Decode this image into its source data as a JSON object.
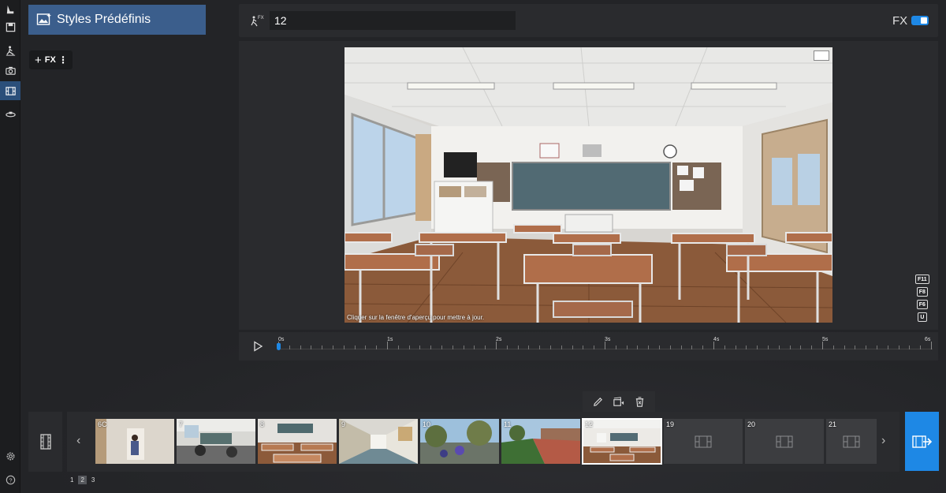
{
  "rail": {
    "items": [
      {
        "icon": "scene-icon"
      },
      {
        "icon": "save-icon"
      },
      {
        "icon": "pose-icon"
      },
      {
        "icon": "camera-icon"
      },
      {
        "icon": "film-icon",
        "active": true
      },
      {
        "icon": "rotate-icon"
      }
    ],
    "bottom": [
      {
        "icon": "gear-icon"
      },
      {
        "icon": "help-icon"
      }
    ]
  },
  "styles_panel": {
    "title": "Styles Prédéfinis",
    "add_fx_label": "FX",
    "add_plus": "+",
    "more": "⋮"
  },
  "topbar": {
    "name_value": "12",
    "fx_label": "FX",
    "fx_enabled": true
  },
  "preview": {
    "caption": "Cliquer sur la fenêtre d'aperçu pour mettre à jour.",
    "shortcut_keys": [
      "F11",
      "F8",
      "F6",
      "U"
    ]
  },
  "timeline": {
    "labels": [
      "0s",
      "1s",
      "2s",
      "3s",
      "4s",
      "5s",
      "6s"
    ],
    "playhead_seconds": 0,
    "duration_seconds": 6
  },
  "clip_actions": [
    "edit-icon",
    "clip-settings-icon",
    "delete-icon"
  ],
  "filmstrip": {
    "prev": "‹",
    "next": "›",
    "thumbs": [
      {
        "num": "6C",
        "kind": "room"
      },
      {
        "num": "7",
        "kind": "classroom-wide"
      },
      {
        "num": "8",
        "kind": "classroom-desks"
      },
      {
        "num": "9",
        "kind": "hallway"
      },
      {
        "num": "10",
        "kind": "outdoor-trees"
      },
      {
        "num": "11",
        "kind": "outdoor-path"
      },
      {
        "num": "12",
        "kind": "classroom",
        "selected": true
      },
      {
        "num": "19",
        "kind": "empty"
      },
      {
        "num": "20",
        "kind": "empty"
      },
      {
        "num": "21",
        "kind": "empty"
      }
    ]
  },
  "pager": {
    "pages": [
      "1",
      "2",
      "3"
    ],
    "current": "2"
  },
  "colors": {
    "accent": "#1e88e5",
    "panel": "#2a2b2e",
    "header": "#3b5e8c"
  }
}
